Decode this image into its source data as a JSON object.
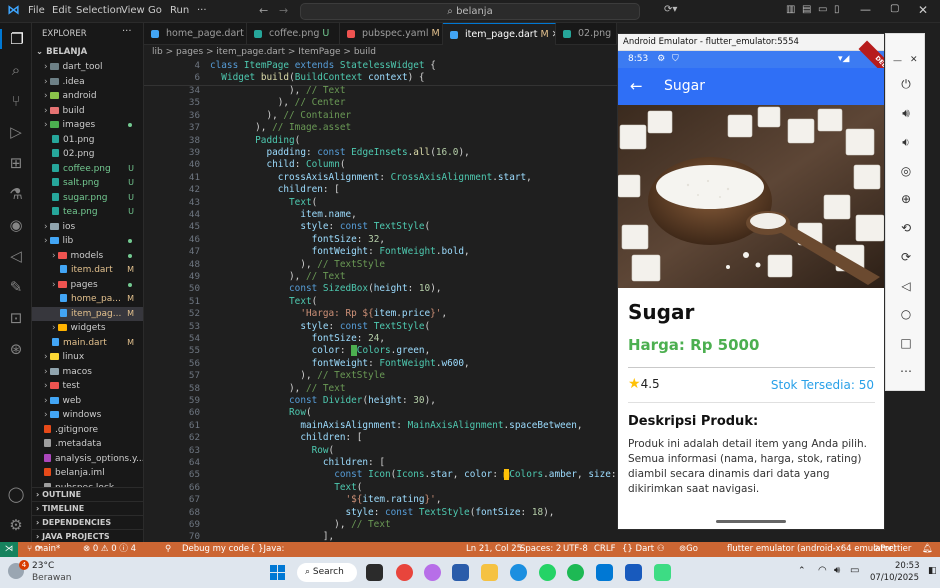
{
  "titlebar": {
    "menus": [
      "File",
      "Edit",
      "Selection",
      "View",
      "Go",
      "Run",
      "···"
    ],
    "search": "belanja"
  },
  "explorer": {
    "header": "EXPLORER",
    "root": "BELANJA",
    "items": [
      {
        "label": "dart_tool",
        "indent": 1,
        "type": "folder",
        "color": "#6d8086",
        "badge": ""
      },
      {
        "label": ".idea",
        "indent": 1,
        "type": "folder",
        "color": "#6d8086",
        "badge": ""
      },
      {
        "label": "android",
        "indent": 1,
        "type": "folder",
        "color": "#8bc34a",
        "badge": ""
      },
      {
        "label": "build",
        "indent": 1,
        "type": "folder",
        "color": "#e57373",
        "badge": ""
      },
      {
        "label": "images",
        "indent": 1,
        "type": "folder",
        "color": "#4caf50",
        "badge": "dot"
      },
      {
        "label": "01.png",
        "indent": 2,
        "type": "file",
        "color": "#26a69a",
        "badge": ""
      },
      {
        "label": "02.png",
        "indent": 2,
        "type": "file",
        "color": "#26a69a",
        "badge": ""
      },
      {
        "label": "coffee.png",
        "indent": 2,
        "type": "file",
        "color": "#26a69a",
        "badge": "U"
      },
      {
        "label": "salt.png",
        "indent": 2,
        "type": "file",
        "color": "#26a69a",
        "badge": "U"
      },
      {
        "label": "sugar.png",
        "indent": 2,
        "type": "file",
        "color": "#26a69a",
        "badge": "U"
      },
      {
        "label": "tea.png",
        "indent": 2,
        "type": "file",
        "color": "#26a69a",
        "badge": "U"
      },
      {
        "label": "ios",
        "indent": 1,
        "type": "folder",
        "color": "#90a4ae",
        "badge": ""
      },
      {
        "label": "lib",
        "indent": 1,
        "type": "folder",
        "color": "#42a5f5",
        "badge": "dot"
      },
      {
        "label": "models",
        "indent": 2,
        "type": "folder",
        "color": "#ef5350",
        "badge": "dot"
      },
      {
        "label": "item.dart",
        "indent": 3,
        "type": "file",
        "color": "#42a5f5",
        "badge": "M"
      },
      {
        "label": "pages",
        "indent": 2,
        "type": "folder",
        "color": "#ef5350",
        "badge": "dot"
      },
      {
        "label": "home_pa...",
        "indent": 3,
        "type": "file",
        "color": "#42a5f5",
        "badge": "M"
      },
      {
        "label": "item_pag...",
        "indent": 3,
        "type": "file",
        "color": "#42a5f5",
        "badge": "M"
      },
      {
        "label": "widgets",
        "indent": 2,
        "type": "folder",
        "color": "#ffb300",
        "badge": ""
      },
      {
        "label": "main.dart",
        "indent": 2,
        "type": "file",
        "color": "#42a5f5",
        "badge": "M"
      },
      {
        "label": "linux",
        "indent": 1,
        "type": "folder",
        "color": "#fdd835",
        "badge": ""
      },
      {
        "label": "macos",
        "indent": 1,
        "type": "folder",
        "color": "#90a4ae",
        "badge": ""
      },
      {
        "label": "test",
        "indent": 1,
        "type": "folder",
        "color": "#ef5350",
        "badge": ""
      },
      {
        "label": "web",
        "indent": 1,
        "type": "folder",
        "color": "#42a5f5",
        "badge": ""
      },
      {
        "label": "windows",
        "indent": 1,
        "type": "folder",
        "color": "#42a5f5",
        "badge": ""
      },
      {
        "label": ".gitignore",
        "indent": 1,
        "type": "file",
        "color": "#e64a19",
        "badge": ""
      },
      {
        "label": ".metadata",
        "indent": 1,
        "type": "file",
        "color": "#9e9e9e",
        "badge": ""
      },
      {
        "label": "analysis_options.y...",
        "indent": 1,
        "type": "file",
        "color": "#ab47bc",
        "badge": ""
      },
      {
        "label": "belanja.iml",
        "indent": 1,
        "type": "file",
        "color": "#e64a19",
        "badge": ""
      },
      {
        "label": "pubspec.lock",
        "indent": 1,
        "type": "file",
        "color": "#9e9e9e",
        "badge": ""
      }
    ],
    "sections": [
      "OUTLINE",
      "TIMELINE",
      "DEPENDENCIES",
      "JAVA PROJECTS"
    ]
  },
  "tabs": [
    {
      "label": "home_page.dart",
      "flag": "M",
      "color": "#42a5f5",
      "active": false
    },
    {
      "label": "coffee.png",
      "flag": "U",
      "color": "#26a69a",
      "active": false
    },
    {
      "label": "pubspec.yaml",
      "flag": "M",
      "color": "#ef5350",
      "active": false
    },
    {
      "label": "item_page.dart",
      "flag": "M",
      "color": "#42a5f5",
      "active": true
    },
    {
      "label": "02.png",
      "flag": "",
      "color": "#26a69a",
      "active": false
    }
  ],
  "breadcrumb": "lib > pages > item_page.dart > ItemPage > build",
  "code": {
    "sticky": [
      {
        "n": "4",
        "t": "<span class='k'>class</span> <span class='c'>ItemPage</span> <span class='k'>extends</span> <span class='c'>StatelessWidget</span> {"
      },
      {
        "n": "6",
        "t": "  <span class='c'>Widget</span> <span class='m'>build</span>(<span class='c'>BuildContext</span> <span class='p'>context</span>) {"
      }
    ],
    "lines": [
      {
        "n": "34",
        "t": "              ), <span class='cm'>// Text</span>"
      },
      {
        "n": "35",
        "t": "            ), <span class='cm'>// Center</span>"
      },
      {
        "n": "36",
        "t": "          ), <span class='cm'>// Container</span>"
      },
      {
        "n": "37",
        "t": "        ), <span class='cm'>// Image.asset</span>"
      },
      {
        "n": "38",
        "t": "        <span class='c'>Padding</span>("
      },
      {
        "n": "39",
        "t": "          <span class='p'>padding</span>: <span class='k'>const</span> <span class='c'>EdgeInsets</span>.<span class='m'>all</span>(<span class='n'>16.0</span>),"
      },
      {
        "n": "40",
        "t": "          <span class='p'>child</span>: <span class='c'>Column</span>("
      },
      {
        "n": "41",
        "t": "            <span class='p'>crossAxisAlignment</span>: <span class='c'>CrossAxisAlignment</span>.<span class='p'>start</span>,"
      },
      {
        "n": "42",
        "t": "            <span class='p'>children</span>: ["
      },
      {
        "n": "43",
        "t": "              <span class='c'>Text</span>("
      },
      {
        "n": "44",
        "t": "                <span class='p'>item</span>.<span class='p'>name</span>,"
      },
      {
        "n": "45",
        "t": "                <span class='p'>style</span>: <span class='k'>const</span> <span class='c'>TextStyle</span>("
      },
      {
        "n": "46",
        "t": "                  <span class='p'>fontSize</span>: <span class='n'>32</span>,"
      },
      {
        "n": "47",
        "t": "                  <span class='p'>fontWeight</span>: <span class='c'>FontWeight</span>.<span class='p'>bold</span>,"
      },
      {
        "n": "48",
        "t": "                ), <span class='cm'>// TextStyle</span>"
      },
      {
        "n": "49",
        "t": "              ), <span class='cm'>// Text</span>"
      },
      {
        "n": "50",
        "t": "              <span class='k'>const</span> <span class='c'>SizedBox</span>(<span class='p'>height</span>: <span class='n'>10</span>),"
      },
      {
        "n": "51",
        "t": "              <span class='c'>Text</span>("
      },
      {
        "n": "52",
        "t": "                <span class='s'>'Harga: Rp ${</span><span class='p'>item</span>.<span class='p'>price</span><span class='s'>}'</span>,"
      },
      {
        "n": "53",
        "t": "                <span class='p'>style</span>: <span class='k'>const</span> <span class='c'>TextStyle</span>("
      },
      {
        "n": "54",
        "t": "                  <span class='p'>fontSize</span>: <span class='n'>24</span>,"
      },
      {
        "n": "55",
        "t": "                  <span class='p'>color</span>: <span style='background:#4caf50;color:#4caf50'>■</span><span class='c'>Colors</span>.<span class='p'>green</span>,"
      },
      {
        "n": "56",
        "t": "                  <span class='p'>fontWeight</span>: <span class='c'>FontWeight</span>.<span class='p'>w600</span>,"
      },
      {
        "n": "57",
        "t": "                ), <span class='cm'>// TextStyle</span>"
      },
      {
        "n": "58",
        "t": "              ), <span class='cm'>// Text</span>"
      },
      {
        "n": "59",
        "t": "              <span class='k'>const</span> <span class='c'>Divider</span>(<span class='p'>height</span>: <span class='n'>30</span>),"
      },
      {
        "n": "60",
        "t": "              <span class='c'>Row</span>("
      },
      {
        "n": "61",
        "t": "                <span class='p'>mainAxisAlignment</span>: <span class='c'>MainAxisAlignment</span>.<span class='p'>spaceBetween</span>,"
      },
      {
        "n": "62",
        "t": "                <span class='p'>children</span>: ["
      },
      {
        "n": "63",
        "t": "                  <span class='c'>Row</span>("
      },
      {
        "n": "64",
        "t": "                    <span class='p'>children</span>: ["
      },
      {
        "n": "65",
        "t": "                      <span class='k'>const</span> <span class='c'>Icon</span>(<span class='c'>Icons</span>.<span class='p'>star</span>, <span class='p'>color</span>: <span style='background:#ffc107;color:#ffc107'>■</span><span class='c'>Colors</span>.<span class='p'>amber</span>, <span class='p'>size</span>: <span class='n'>24</span>),"
      },
      {
        "n": "66",
        "t": "                      <span class='c'>Text</span>("
      },
      {
        "n": "67",
        "t": "                        <span class='s'>'${</span><span class='p'>item</span>.<span class='p'>rating</span><span class='s'>}'</span>,"
      },
      {
        "n": "68",
        "t": "                        <span class='p'>style</span>: <span class='k'>const</span> <span class='c'>TextStyle</span>(<span class='p'>fontSize</span>: <span class='n'>18</span>),"
      },
      {
        "n": "69",
        "t": "                      ), <span class='cm'>// Text</span>"
      },
      {
        "n": "70",
        "t": "                    ],"
      }
    ]
  },
  "statusbar": {
    "branch": "main*",
    "problems": "⊗ 0  ⚠ 0  ⓘ 4",
    "debug": "Debug my code",
    "java": "Java: Ready",
    "position": "Ln 21, Col 25",
    "spaces": "Spaces: 2",
    "encoding": "UTF-8",
    "eol": "CRLF",
    "language": "{} Dart",
    "golive": "Go Live",
    "device": "flutter emulator (android-x64 emulator)",
    "prettier": "Prettier"
  },
  "emulator": {
    "window_title": "Android Emulator - flutter_emulator:5554",
    "time": "8:53",
    "debug_banner": "DEBUG",
    "appbar_title": "Sugar",
    "product_name": "Sugar",
    "price": "Harga: Rp 5000",
    "rating": "4.5",
    "stock": "Stok Tersedia: 50",
    "desc_title": "Deskripsi Produk:",
    "desc_body": "Produk ini adalah detail item yang Anda pilih. Semua informasi (nama, harga, stok, rating) diambil secara dinamis dari data yang dikirimkan saat navigasi.",
    "accent_blue": "#2f6ff6",
    "price_green": "#4caf50",
    "stock_blue": "#29a0e8",
    "star_color": "#ffc107"
  },
  "taskbar": {
    "weather_temp": "23°C",
    "weather_desc": "Berawan",
    "search": "Search",
    "time": "20:53",
    "date": "07/10/2025",
    "notif_count": "4"
  }
}
